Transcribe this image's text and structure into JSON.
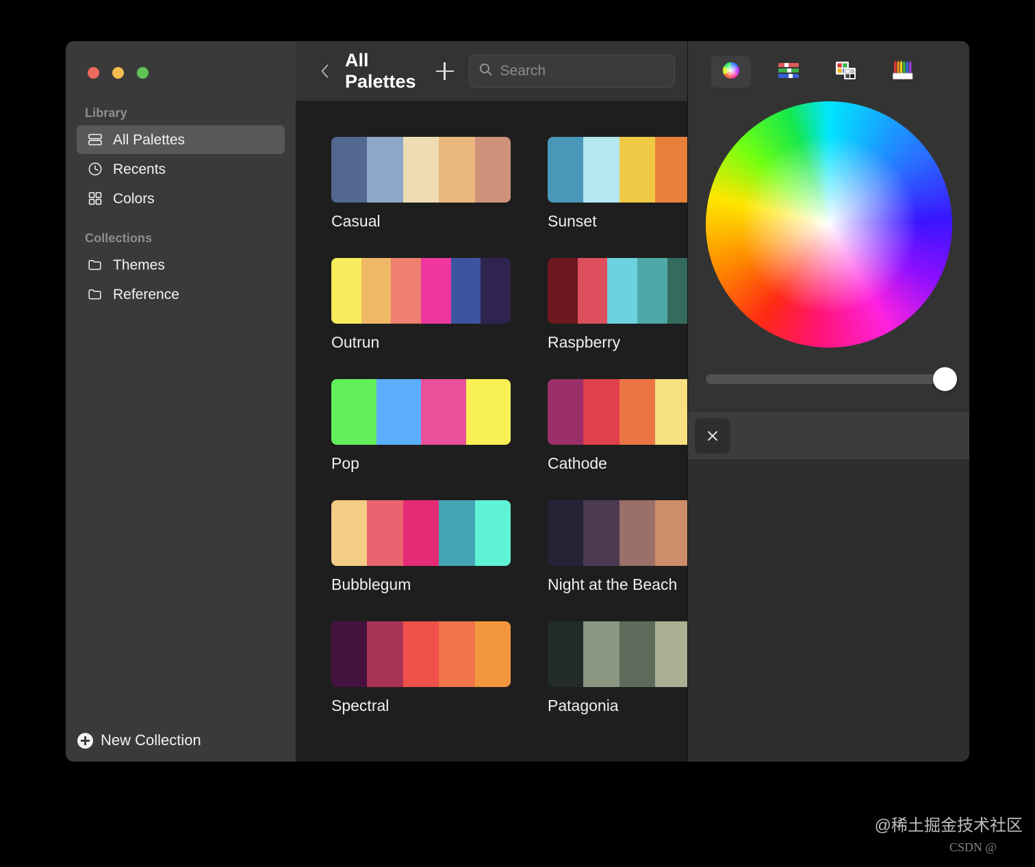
{
  "window": {
    "traffic_lights": [
      {
        "name": "close",
        "color": "#ee6a5f"
      },
      {
        "name": "minimize",
        "color": "#f5bd4f"
      },
      {
        "name": "zoom",
        "color": "#61c454"
      }
    ]
  },
  "sidebar": {
    "sections": [
      {
        "label": "Library",
        "items": [
          {
            "label": "All Palettes",
            "icon": "rows-icon",
            "selected": true
          },
          {
            "label": "Recents",
            "icon": "clock-icon",
            "selected": false
          },
          {
            "label": "Colors",
            "icon": "grid-icon",
            "selected": false
          }
        ]
      },
      {
        "label": "Collections",
        "items": [
          {
            "label": "Themes",
            "icon": "folder-icon",
            "selected": false
          },
          {
            "label": "Reference",
            "icon": "folder-icon",
            "selected": false
          }
        ]
      }
    ],
    "new_collection_label": "New Collection"
  },
  "toolbar": {
    "back_icon": "chevron-left-icon",
    "title": "All Palettes",
    "add_icon": "plus-icon",
    "search_placeholder": "Search",
    "search_value": "",
    "search_icon": "search-icon"
  },
  "palettes": [
    {
      "name": "Casual",
      "colors": [
        "#53688F",
        "#8DA8C6",
        "#EDDCB4",
        "#E9B77D",
        "#CE927A"
      ]
    },
    {
      "name": "Sunset",
      "colors": [
        "#4A97B9",
        "#B4E7F0",
        "#EFC946",
        "#E8803A",
        "#E06C54"
      ]
    },
    {
      "name": "Outrun",
      "colors": [
        "#F8EC5C",
        "#EFB866",
        "#EF7F6E",
        "#EE38A0",
        "#3D55A0",
        "#2F2450"
      ]
    },
    {
      "name": "Raspberry",
      "colors": [
        "#6D1820",
        "#DE4F5E",
        "#6CD2DE",
        "#4FA8A8",
        "#356B5F",
        "#FFFFFF"
      ]
    },
    {
      "name": "Pop",
      "colors": [
        "#63EF5C",
        "#5AAEFB",
        "#E8509A",
        "#FAF255"
      ]
    },
    {
      "name": "Cathode",
      "colors": [
        "#9B2F68",
        "#E03F4C",
        "#EC7544",
        "#F6E080",
        "#4C97A0"
      ]
    },
    {
      "name": "Bubblegum",
      "colors": [
        "#F3CC85",
        "#E8646E",
        "#E52B75",
        "#46A5B5",
        "#5FF2D4"
      ]
    },
    {
      "name": "Night at the Beach",
      "colors": [
        "#262236",
        "#4C3A52",
        "#9A7068",
        "#CD8D6B",
        "#F5BE73"
      ]
    },
    {
      "name": "Spectral",
      "colors": [
        "#44123E",
        "#A93355",
        "#F0524A",
        "#F2744A",
        "#F3973E"
      ]
    },
    {
      "name": "Patagonia",
      "colors": [
        "#232B2B",
        "#8A9680",
        "#5D6B5A",
        "#A9B093",
        "#E5E2C0"
      ]
    }
  ],
  "inspector": {
    "picker_tabs": [
      {
        "name": "color-wheel-icon",
        "active": true
      },
      {
        "name": "color-sliders-icon",
        "active": false
      },
      {
        "name": "color-palettes-icon",
        "active": false
      },
      {
        "name": "crayons-icon",
        "active": false
      }
    ],
    "opacity_percent": 100,
    "close_chip_icon": "close-icon"
  },
  "watermark": {
    "primary": "@稀土掘金技术社区",
    "secondary": "CSDN @"
  }
}
